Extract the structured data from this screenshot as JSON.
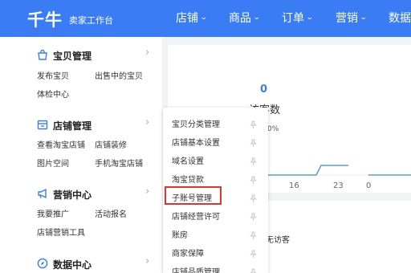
{
  "brand": {
    "logo": "千牛",
    "subtitle": "卖家工作台"
  },
  "nav": [
    {
      "label": "店铺"
    },
    {
      "label": "商品"
    },
    {
      "label": "订单"
    },
    {
      "label": "营销"
    },
    {
      "label": "数据"
    }
  ],
  "sidebar": {
    "groups": [
      {
        "title": "宝贝管理",
        "icon": "bag-icon",
        "links": [
          "发布宝贝",
          "出售中的宝贝",
          "体检中心"
        ]
      },
      {
        "title": "店铺管理",
        "icon": "store-icon",
        "links": [
          "查看淘宝店铺",
          "店铺装修",
          "图片空间",
          "手机淘宝店铺"
        ]
      },
      {
        "title": "营销中心",
        "icon": "megaphone-icon",
        "links": [
          "我要推广",
          "活动报名",
          "店铺营销工具"
        ]
      },
      {
        "title": "数据中心",
        "icon": "compass-icon",
        "links": []
      }
    ]
  },
  "dropdown": {
    "items": [
      "宝贝分类管理",
      "店铺基本设置",
      "域名设置",
      "淘宝贷款",
      "子账号管理",
      "店铺经营许可",
      "账房",
      "商家保障",
      "店铺品质管理"
    ],
    "highlighted": "子账号管理"
  },
  "stats": {
    "value": "0",
    "label": "访客数",
    "pct": "0%",
    "axis": [
      "16",
      "23",
      "0"
    ],
    "empty_text": "暂无访客"
  },
  "colors": {
    "brand": "#3a7cf3",
    "highlight": "#e3332e"
  }
}
